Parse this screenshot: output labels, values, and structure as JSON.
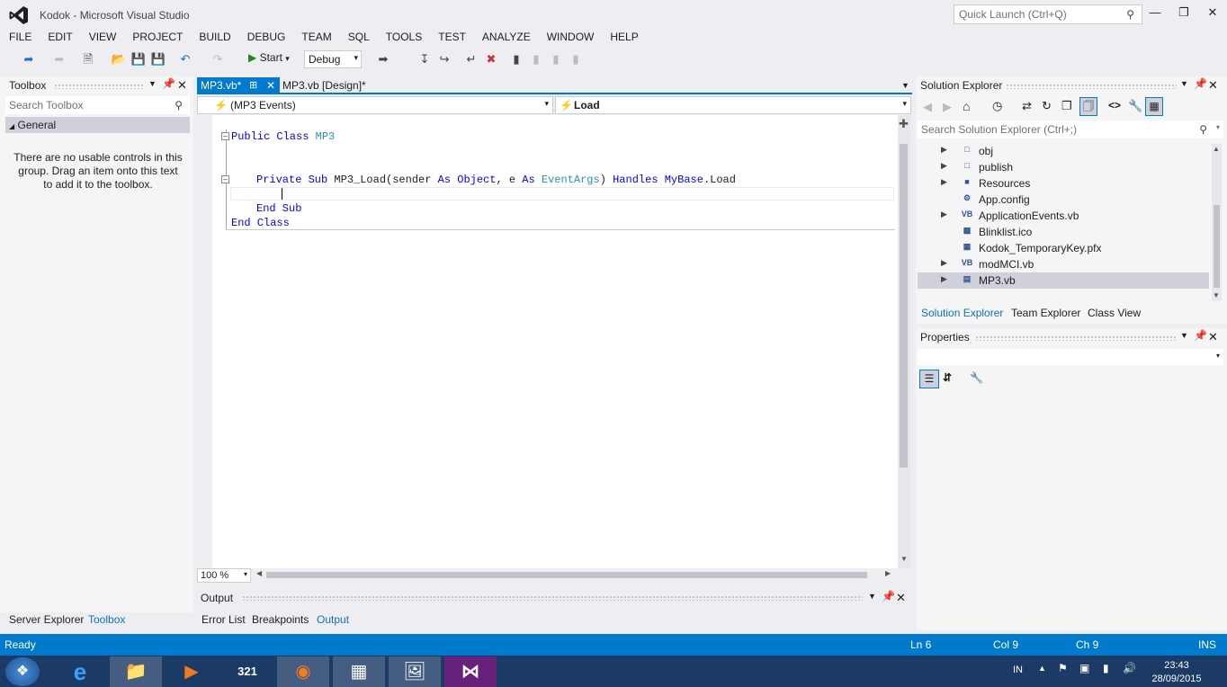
{
  "window": {
    "title": "Kodok - Microsoft Visual Studio",
    "quick_launch_placeholder": "Quick Launch (Ctrl+Q)"
  },
  "menu": [
    "FILE",
    "EDIT",
    "VIEW",
    "PROJECT",
    "BUILD",
    "DEBUG",
    "TEAM",
    "SQL",
    "TOOLS",
    "TEST",
    "ANALYZE",
    "WINDOW",
    "HELP"
  ],
  "toolbar": {
    "start_label": "Start",
    "config": "Debug"
  },
  "toolbox": {
    "title": "Toolbox",
    "search_placeholder": "Search Toolbox",
    "group": "General",
    "empty_text": "There are no usable controls in this group. Drag an item onto this text to add it to the toolbox.",
    "tabs": [
      "Server Explorer",
      "Toolbox"
    ]
  },
  "editor": {
    "tabs": [
      "MP3.vb*",
      "MP3.vb [Design]*"
    ],
    "nav_left": "(MP3 Events)",
    "nav_right": "Load",
    "zoom": "100 %",
    "lines": {
      "l1_kw": "Public Class ",
      "l1_ty": "MP3",
      "l2_kw1": "Private Sub ",
      "l2_a": "MP3_Load(sender ",
      "l2_kw2": "As ",
      "l2_ty1": "Object",
      "l2_b": ", e ",
      "l2_kw3": "As ",
      "l2_ty2": "EventArgs",
      "l2_c": ") ",
      "l2_kw4": "Handles ",
      "l2_kw5": "MyBase",
      "l2_d": ".Load",
      "l3": "End Sub",
      "l4": "End Class"
    }
  },
  "output": {
    "title": "Output",
    "tabs": [
      "Error List",
      "Breakpoints",
      "Output"
    ]
  },
  "solution_explorer": {
    "title": "Solution Explorer",
    "search_placeholder": "Search Solution Explorer (Ctrl+;)",
    "items": [
      {
        "label": "obj",
        "icon": "folder-dashed"
      },
      {
        "label": "publish",
        "icon": "folder-dashed"
      },
      {
        "label": "Resources",
        "icon": "folder"
      },
      {
        "label": "App.config",
        "icon": "config"
      },
      {
        "label": "ApplicationEvents.vb",
        "icon": "vb"
      },
      {
        "label": "Blinklist.ico",
        "icon": "image"
      },
      {
        "label": "Kodok_TemporaryKey.pfx",
        "icon": "certificate"
      },
      {
        "label": "modMCI.vb",
        "icon": "vb"
      },
      {
        "label": "MP3.vb",
        "icon": "form"
      }
    ],
    "tabs": [
      "Solution Explorer",
      "Team Explorer",
      "Class View"
    ]
  },
  "properties": {
    "title": "Properties"
  },
  "status": {
    "ready": "Ready",
    "ln": "Ln 6",
    "col": "Col 9",
    "ch": "Ch 9",
    "ins": "INS"
  },
  "taskbar": {
    "lang": "IN",
    "time": "23:43",
    "date": "28/09/2015"
  },
  "colors": {
    "accent": "#007acc",
    "taskbar": "#1b3a66"
  }
}
